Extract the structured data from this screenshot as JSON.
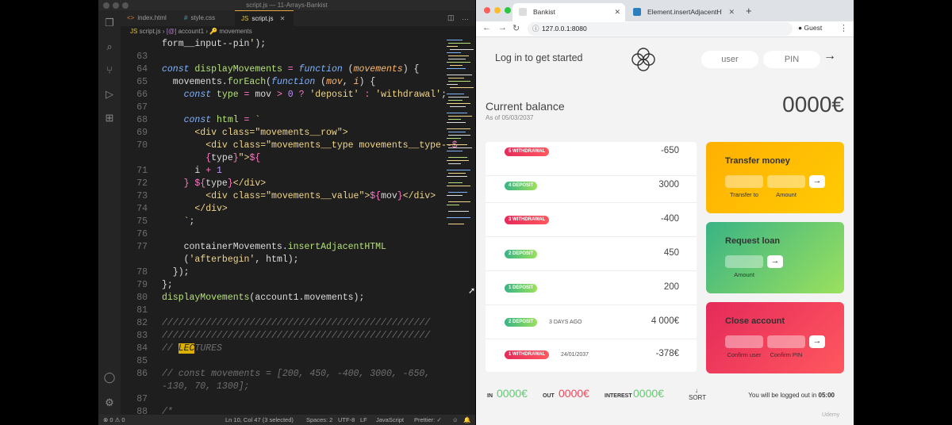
{
  "vscode": {
    "window_title": "script.js — 11-Arrays-Bankist",
    "tabs": [
      {
        "label": "index.html",
        "icon": "<>"
      },
      {
        "label": "style.css",
        "icon": "#"
      },
      {
        "label": "script.js",
        "icon": "JS"
      }
    ],
    "breadcrumb": [
      "script.js",
      "account1",
      "movements"
    ],
    "line_numbers": [
      "63",
      "64",
      "65",
      "66",
      "67",
      "68",
      "69",
      "70",
      "71",
      "72",
      "73",
      "74",
      "75",
      "76",
      "77",
      "78",
      "79",
      "80",
      "81",
      "82",
      "83",
      "84",
      "85",
      "86",
      "87",
      "88"
    ],
    "status": {
      "position": "Ln 10, Col 47 (3 selected)",
      "spaces": "Spaces: 2",
      "encoding": "UTF-8",
      "eol": "LF",
      "language": "JavaScript",
      "formatter": "Prettier: ✓"
    }
  },
  "browser": {
    "tabs": [
      {
        "label": "Bankist"
      },
      {
        "label": "Element.insertAdjacentHTML()"
      }
    ],
    "url": "127.0.0.1:8080",
    "profile": "Guest"
  },
  "bankist": {
    "welcome": "Log in to get started",
    "user_placeholder": "user",
    "pin_placeholder": "PIN",
    "login_arrow": "→",
    "balance_label": "Current balance",
    "balance_date": "As of 05/03/2037",
    "balance_value": "0000€",
    "movements": [
      {
        "type": "5 WITHDRAWAL",
        "kind": "withdrawal",
        "date": "",
        "value": "-650"
      },
      {
        "type": "4 DEPOSIT",
        "kind": "deposit",
        "date": "",
        "value": "3000"
      },
      {
        "type": "3 WITHDRAWAL",
        "kind": "withdrawal",
        "date": "",
        "value": "-400"
      },
      {
        "type": "2 DEPOSIT",
        "kind": "deposit",
        "date": "",
        "value": "450"
      },
      {
        "type": "1 DEPOSIT",
        "kind": "deposit",
        "date": "",
        "value": "200"
      },
      {
        "type": "2 DEPOSIT",
        "kind": "deposit",
        "date": "3 DAYS AGO",
        "value": "4 000€"
      },
      {
        "type": "1 WITHDRAWAL",
        "kind": "withdrawal",
        "date": "24/01/2037",
        "value": "-378€"
      }
    ],
    "transfer": {
      "title": "Transfer money",
      "label_to": "Transfer to",
      "label_amount": "Amount",
      "button": "→"
    },
    "loan": {
      "title": "Request loan",
      "label_amount": "Amount",
      "button": "→"
    },
    "close": {
      "title": "Close account",
      "label_user": "Confirm user",
      "label_pin": "Confirm PIN",
      "button": "→"
    },
    "summary": {
      "in_label": "IN",
      "in_value": "0000€",
      "out_label": "OUT",
      "out_value": "0000€",
      "interest_label": "INTEREST",
      "interest_value": "0000€",
      "sort_label": "SORT",
      "sort_arrow": "↓"
    },
    "timer_text": "You will be logged out in",
    "timer_value": "05:00"
  },
  "colors": {
    "deposit": "#39b385",
    "withdrawal": "#e52a5a",
    "transfer": "#ffb003",
    "in_value": "#66c873",
    "out_value": "#f5465d"
  },
  "watermark": "Udemy"
}
